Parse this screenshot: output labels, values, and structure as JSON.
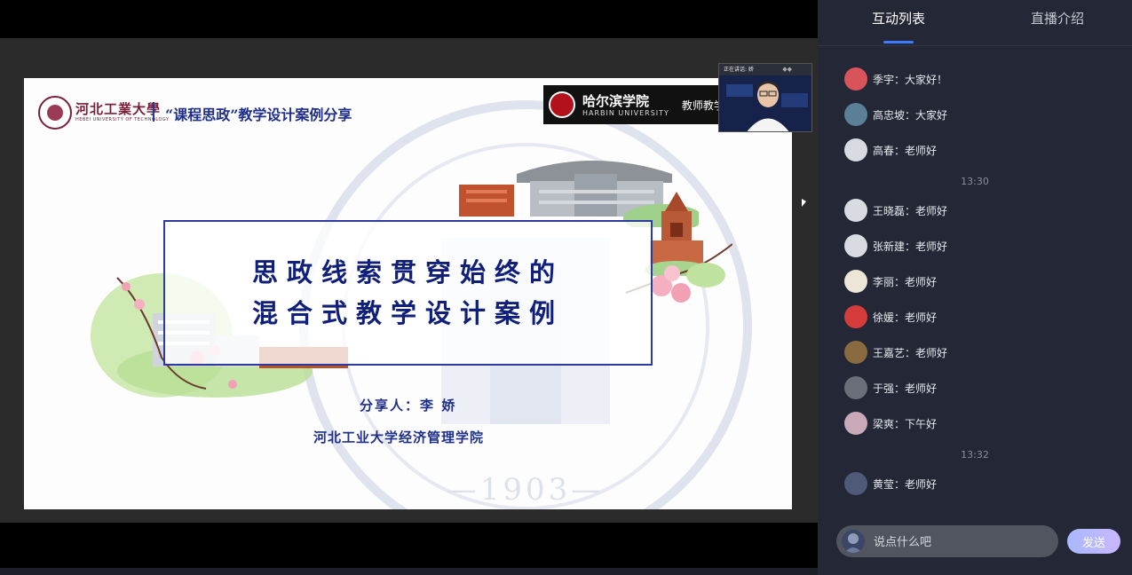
{
  "slide": {
    "university_name": "河北工業大學",
    "university_name_en": "HEBEI UNIVERSITY OF TECHNOLOGY",
    "header_title": "“课程思政”教学设计案例分享",
    "banner_name_cn": "哈尔滨学院",
    "banner_name_en": "HARBIN UNIVERSITY",
    "banner_tag": "教师教学",
    "title_line_1": "思政线索贯穿始终的",
    "title_line_2": "混合式教学设计案例",
    "presenter": "分享人：李 娇",
    "college": "河北工业大学经济管理学院",
    "watermark_year": "—1903—"
  },
  "webcam": {
    "label": "正在讲话: 娇"
  },
  "tabs": [
    {
      "label": "互动列表",
      "active": true
    },
    {
      "label": "直播介绍",
      "active": false
    }
  ],
  "chat": {
    "messages": [
      {
        "user": "季宇",
        "text": "季宇：大家好！",
        "avatar_color": "#d9535a"
      },
      {
        "user": "高忠坡",
        "text": "高忠坡：大家好",
        "avatar_color": "#5a7f96"
      },
      {
        "user": "高春",
        "text": "高春：老师好",
        "avatar_color": "#d8dbe2"
      },
      {
        "time": "13:30"
      },
      {
        "user": "王晓磊",
        "text": "王晓磊：老师好",
        "avatar_color": "#d8dbe2"
      },
      {
        "user": "张新建",
        "text": "张新建：老师好",
        "avatar_color": "#d8dbe2"
      },
      {
        "user": "李丽",
        "text": "李丽：老师好",
        "avatar_color": "#ece6d8"
      },
      {
        "user": "徐媛",
        "text": "徐媛：老师好",
        "avatar_color": "#d63b3b"
      },
      {
        "user": "王嘉艺",
        "text": "王嘉艺：老师好",
        "avatar_color": "#8a6a3f"
      },
      {
        "user": "于强",
        "text": "于强：老师好",
        "avatar_color": "#6b6f7a"
      },
      {
        "user": "梁爽",
        "text": "梁爽：下午好",
        "avatar_color": "#c9a9b8"
      },
      {
        "time": "13:32"
      },
      {
        "user": "黄莹",
        "text": "黄莹：老师好",
        "avatar_color": "#4f5a78"
      }
    ]
  },
  "input": {
    "placeholder": "说点什么吧",
    "send_label": "发送"
  }
}
